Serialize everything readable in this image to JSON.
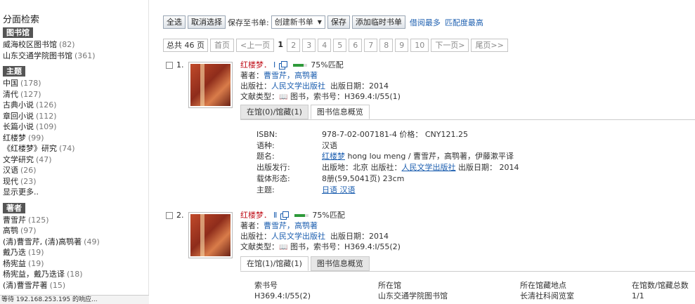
{
  "sidebar": {
    "title": "分面检索",
    "facets": [
      {
        "head": "图书馆",
        "items": [
          {
            "label": "威海校区图书馆",
            "count": "(82)"
          },
          {
            "label": "山东交通学院图书馆",
            "count": "(361)"
          }
        ]
      },
      {
        "head": "主题",
        "items": [
          {
            "label": "中国",
            "count": "(178)"
          },
          {
            "label": "清代",
            "count": "(127)"
          },
          {
            "label": "古典小说",
            "count": "(126)"
          },
          {
            "label": "章回小说",
            "count": "(112)"
          },
          {
            "label": "长篇小说",
            "count": "(109)"
          },
          {
            "label": "红楼梦",
            "count": "(99)"
          },
          {
            "label": "《红楼梦》研究",
            "count": "(74)"
          },
          {
            "label": "文学研究",
            "count": "(47)"
          },
          {
            "label": "汉语",
            "count": "(26)"
          },
          {
            "label": "现代",
            "count": "(23)"
          }
        ],
        "more": "显示更多.."
      },
      {
        "head": "著者",
        "items": [
          {
            "label": "曹雪芹",
            "count": "(125)"
          },
          {
            "label": "高鹗",
            "count": "(97)"
          },
          {
            "label": "(清)曹雪芹, (清)高鹗著",
            "count": "(49)"
          },
          {
            "label": "戴乃迭",
            "count": "(19)"
          },
          {
            "label": "杨宪益",
            "count": "(19)"
          },
          {
            "label": "杨宪益，戴乃迭译",
            "count": "(18)"
          },
          {
            "label": "(清)曹雪芹著",
            "count": "(15)"
          }
        ]
      }
    ]
  },
  "statusbar": "等待 192.168.253.195 的响应...",
  "toolbar": {
    "select_all": "全选",
    "deselect": "取消选择",
    "save_to_label": "保存至书单:",
    "save_select_value": "创建新书单",
    "save": "保存",
    "add_temp": "添加临时书单",
    "sort_most_borrowed": "借阅最多",
    "sort_best_match": "匹配度最高"
  },
  "pager": {
    "total": "总共 46 页",
    "first": "首页",
    "prev": "<上一页",
    "pages": [
      "1",
      "2",
      "3",
      "4",
      "5",
      "6",
      "7",
      "8",
      "9",
      "10"
    ],
    "current": "1",
    "next": "下一页>",
    "last": "尾页>>"
  },
  "results": [
    {
      "number": "1.",
      "title": "红楼梦．",
      "volume": "Ⅰ",
      "match": 0.75,
      "match_text": "75%匹配",
      "author_label": "著者：",
      "author": "曹雪芹，高鹗著",
      "publisher_label": "出版社：",
      "publisher": "人民文学出版社",
      "pubdate_label": "出版日期：",
      "pubdate": "2014",
      "doctype_label": "文献类型：",
      "doctype": "图书，索书号：H369.4:I/55(1)",
      "tabs": [
        "在馆(0)/馆藏(1)",
        "图书信息概览"
      ],
      "active_tab": 1,
      "details": [
        {
          "k": "ISBN:",
          "v": "978-7-02-007181-4 价格： CNY121.25"
        },
        {
          "k": "语种:",
          "v": "汉语"
        },
        {
          "k": "题名:",
          "v_link": "红楼梦",
          "v": " hong lou meng / 曹雪芹，高鹗著，伊藤漱平译"
        },
        {
          "k": "出版发行:",
          "v": "出版地：北京 出版社：",
          "v_link2": "人民文学出版社",
          "v_tail": " 出版日期： 2014"
        },
        {
          "k": "载体形态:",
          "v": "8册(59,5041页) 23cm"
        },
        {
          "k": "主题:",
          "v_link": "日语 汉语",
          "v": ""
        }
      ]
    },
    {
      "number": "2.",
      "title": "红楼梦．",
      "volume": "Ⅱ",
      "match": 0.75,
      "match_text": "75%匹配",
      "author_label": "著者：",
      "author": "曹雪芹，高鹗著",
      "publisher_label": "出版社：",
      "publisher": "人民文学出版社",
      "pubdate_label": "出版日期：",
      "pubdate": "2014",
      "doctype_label": "文献类型：",
      "doctype": "图书，索书号：H369.4:I/55(2)",
      "tabs": [
        "在馆(1)/馆藏(1)",
        "图书信息概览"
      ],
      "active_tab": 0,
      "holdings": {
        "headers": [
          "索书号",
          "所在馆",
          "所在馆藏地点",
          "在馆数/馆藏总数"
        ],
        "rows": [
          [
            "H369.4:I/55(2)",
            "山东交通学院图书馆",
            "长清社科阅览室",
            "1/1"
          ]
        ]
      }
    }
  ]
}
